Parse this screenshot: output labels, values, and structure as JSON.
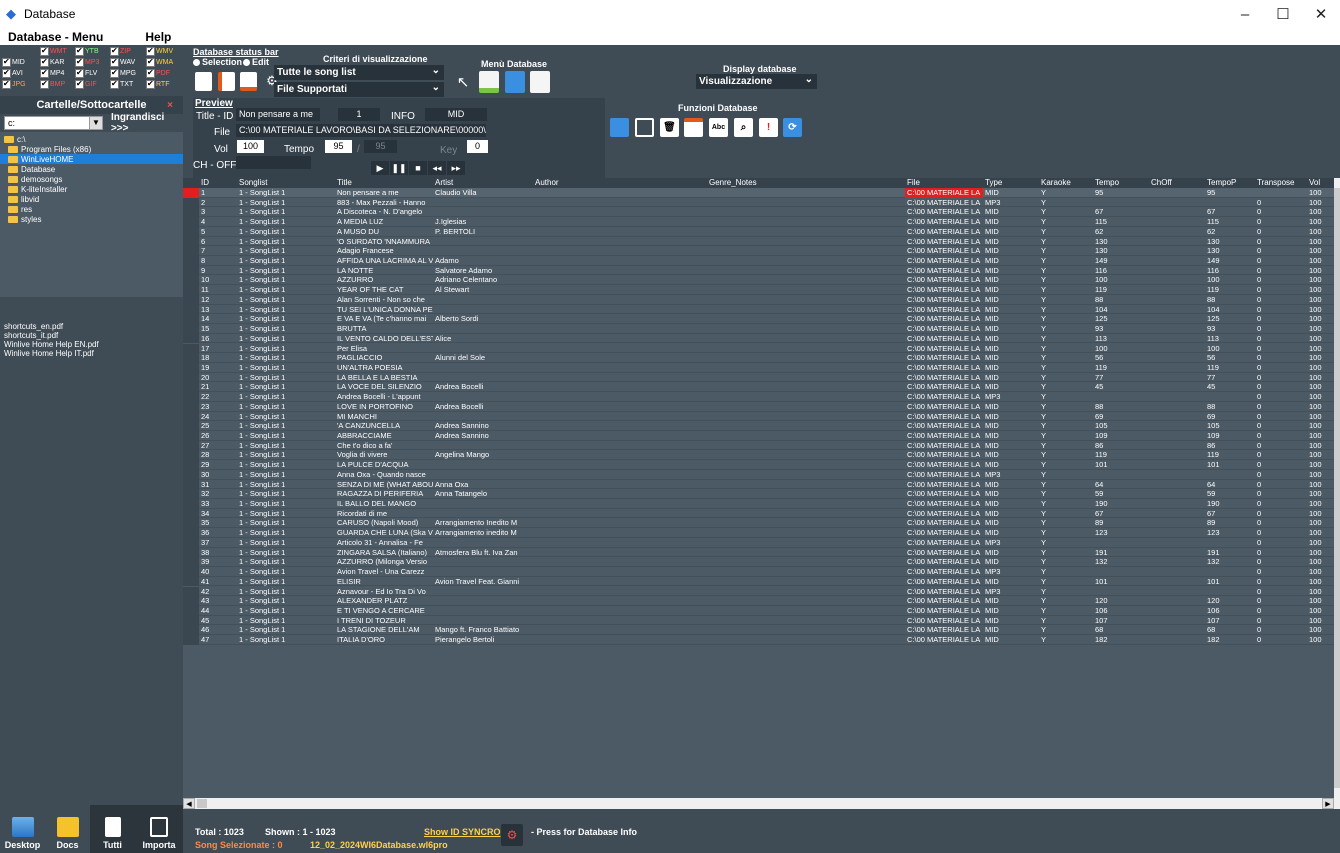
{
  "window": {
    "title": "Database",
    "minimize": "–",
    "maximize": "☐",
    "close": "✕"
  },
  "menu": {
    "items": [
      "Database - Menu",
      "Help"
    ]
  },
  "filetypes": [
    {
      "label": "WMT",
      "color": "red"
    },
    {
      "label": "YTB",
      "color": "grn"
    },
    {
      "label": "ZIP",
      "color": "red"
    },
    {
      "label": "WMV",
      "color": "yel"
    },
    {
      "label": "MID",
      "color": "lbl"
    },
    {
      "label": "KAR",
      "color": "lbl"
    },
    {
      "label": "MP3",
      "color": "red"
    },
    {
      "label": "WAV",
      "color": "lbl"
    },
    {
      "label": "WMA",
      "color": "yel"
    },
    {
      "label": "AVI",
      "color": "lbl"
    },
    {
      "label": "MP4",
      "color": "lbl"
    },
    {
      "label": "FLV",
      "color": "lbl"
    },
    {
      "label": "MPG",
      "color": "lbl"
    },
    {
      "label": "PDF",
      "color": "red"
    },
    {
      "label": "JPG",
      "color": "org"
    },
    {
      "label": "BMP",
      "color": "red"
    },
    {
      "label": "GIF",
      "color": "red"
    },
    {
      "label": "TXT",
      "color": "lbl"
    },
    {
      "label": "RTF",
      "color": "yel"
    }
  ],
  "folders": {
    "header": "Cartelle/Sottocartelle",
    "close": "×",
    "drive": "c:",
    "enlarge": "Ingrandisci >>>",
    "tree": [
      "c:\\",
      "Program Files (x86)",
      "WinLiveHOME",
      "Database",
      "demosongs",
      "K-liteInstaller",
      "libvid",
      "res",
      "styles"
    ],
    "selected_index": 2
  },
  "files": [
    "shortcuts_en.pdf",
    "shortcuts_it.pdf",
    "Winlive Home Help EN.pdf",
    "Winlive Home Help IT.pdf"
  ],
  "bottom_buttons": [
    "Desktop",
    "Docs",
    "Tutti",
    "Importa"
  ],
  "statusbar": {
    "label": "Database status bar",
    "selection": "Selection",
    "edit": "Edit"
  },
  "criteri": {
    "label": "Criteri di visualizzazione",
    "view": "Tutte le song list",
    "files": "File Supportati"
  },
  "menu_database": {
    "label": "Menù Database"
  },
  "display_database": {
    "label": "Display database",
    "value": "Visualizzazione"
  },
  "funzioni_database": {
    "label": "Funzioni Database"
  },
  "preview": {
    "label": "Preview",
    "title_id_label": "Title - ID",
    "title": "Non pensare a me",
    "id": "1",
    "info_label": "INFO",
    "type": "MID",
    "file_label": "File",
    "file": "C:\\00 MATERIALE LAVORO\\BASI DA SELEZIONARE\\00000\\Gui",
    "vol_label": "Vol",
    "vol": "100",
    "tempo_label": "Tempo",
    "tempo": "95",
    "slash": "/",
    "tempo_orig": "95",
    "key_label": "Key",
    "key": "0",
    "choff_label": "CH - OFF",
    "controls": [
      "▶",
      "❚❚",
      "■",
      "◂◂",
      "▸▸"
    ]
  },
  "grid": {
    "columns": [
      "ID",
      "Songlist",
      "Title",
      "Artist",
      "Author",
      "Genre_Notes",
      "File",
      "Type",
      "Karaoke",
      "Tempo",
      "ChOff",
      "TempoP",
      "Transpose",
      "Vol"
    ],
    "rows": [
      [
        "1",
        "1 - SongList 1",
        "Non pensare a me",
        "Claudio Villa",
        "",
        "",
        "C:\\00 MATERIALE LA",
        "MID",
        "Y",
        "95",
        "",
        "95",
        "",
        "100"
      ],
      [
        "2",
        "1 - SongList 1",
        "883 - Max Pezzali - Hanno",
        "",
        "",
        "",
        "C:\\00 MATERIALE LA",
        "MP3",
        "Y",
        "",
        "",
        "",
        "0",
        "100"
      ],
      [
        "3",
        "1 - SongList 1",
        "A Discoteca - N. D'angelo",
        "",
        "",
        "",
        "C:\\00 MATERIALE LA",
        "MID",
        "Y",
        "67",
        "",
        "67",
        "0",
        "100"
      ],
      [
        "4",
        "1 - SongList 1",
        "A MEDIA LUZ",
        "J.Iglesias",
        "",
        "",
        "C:\\00 MATERIALE LA",
        "MID",
        "Y",
        "115",
        "",
        "115",
        "0",
        "100"
      ],
      [
        "5",
        "1 - SongList 1",
        "A MUSO DU",
        "P. BERTOLI",
        "",
        "",
        "C:\\00 MATERIALE LA",
        "MID",
        "Y",
        "62",
        "",
        "62",
        "0",
        "100"
      ],
      [
        "6",
        "1 - SongList 1",
        "'O SURDATO 'NNAMMURA",
        "",
        "",
        "",
        "C:\\00 MATERIALE LA",
        "MID",
        "Y",
        "130",
        "",
        "130",
        "0",
        "100"
      ],
      [
        "7",
        "1 - SongList 1",
        "Adagio Francese",
        "",
        "",
        "",
        "C:\\00 MATERIALE LA",
        "MID",
        "Y",
        "130",
        "",
        "130",
        "0",
        "100"
      ],
      [
        "8",
        "1 - SongList 1",
        "AFFIDA UNA LACRIMA AL VE",
        "Adamo",
        "",
        "",
        "C:\\00 MATERIALE LA",
        "MID",
        "Y",
        "149",
        "",
        "149",
        "0",
        "100"
      ],
      [
        "9",
        "1 - SongList 1",
        "LA NOTTE",
        "Salvatore Adamo",
        "",
        "",
        "C:\\00 MATERIALE LA",
        "MID",
        "Y",
        "116",
        "",
        "116",
        "0",
        "100"
      ],
      [
        "10",
        "1 - SongList 1",
        "AZZURRO",
        "Adriano Celentano",
        "",
        "",
        "C:\\00 MATERIALE LA",
        "MID",
        "Y",
        "100",
        "",
        "100",
        "0",
        "100"
      ],
      [
        "11",
        "1 - SongList 1",
        "YEAR OF THE CAT",
        "Al Stewart",
        "",
        "",
        "C:\\00 MATERIALE LA",
        "MID",
        "Y",
        "119",
        "",
        "119",
        "0",
        "100"
      ],
      [
        "12",
        "1 - SongList 1",
        "Alan Sorrenti - Non so che",
        "",
        "",
        "",
        "C:\\00 MATERIALE LA",
        "MID",
        "Y",
        "88",
        "",
        "88",
        "0",
        "100"
      ],
      [
        "13",
        "1 - SongList 1",
        "TU SEI L'UNICA DONNA PER",
        "",
        "",
        "",
        "C:\\00 MATERIALE LA",
        "MID",
        "Y",
        "104",
        "",
        "104",
        "0",
        "100"
      ],
      [
        "14",
        "1 - SongList 1",
        "E VA E VA (Te c'hanno mai",
        "Alberto Sordi",
        "",
        "",
        "C:\\00 MATERIALE LA",
        "MID",
        "Y",
        "125",
        "",
        "125",
        "0",
        "100"
      ],
      [
        "15",
        "1 - SongList 1",
        "BRUTTA",
        "",
        "",
        "",
        "C:\\00 MATERIALE LA",
        "MID",
        "Y",
        "93",
        "",
        "93",
        "0",
        "100"
      ],
      [
        "16",
        "1 - SongList 1",
        "IL VENTO CALDO DELL'EST",
        "Alice",
        "",
        "",
        "C:\\00 MATERIALE LA",
        "MID",
        "Y",
        "113",
        "",
        "113",
        "0",
        "100"
      ],
      [
        "17",
        "1 - SongList 1",
        "Per Elisa",
        "",
        "",
        "",
        "C:\\00 MATERIALE LA",
        "MID",
        "Y",
        "100",
        "",
        "100",
        "0",
        "100"
      ],
      [
        "18",
        "1 - SongList 1",
        "PAGLIACCIO",
        "Alunni del Sole",
        "",
        "",
        "C:\\00 MATERIALE LA",
        "MID",
        "Y",
        "56",
        "",
        "56",
        "0",
        "100"
      ],
      [
        "19",
        "1 - SongList 1",
        "UN'ALTRA POESIA",
        "",
        "",
        "",
        "C:\\00 MATERIALE LA",
        "MID",
        "Y",
        "119",
        "",
        "119",
        "0",
        "100"
      ],
      [
        "20",
        "1 - SongList 1",
        "LA BELLA E LA BESTIA",
        "",
        "",
        "",
        "C:\\00 MATERIALE LA",
        "MID",
        "Y",
        "77",
        "",
        "77",
        "0",
        "100"
      ],
      [
        "21",
        "1 - SongList 1",
        "LA VOCE DEL SILENZIO",
        "Andrea Bocelli",
        "",
        "",
        "C:\\00 MATERIALE LA",
        "MID",
        "Y",
        "45",
        "",
        "45",
        "0",
        "100"
      ],
      [
        "22",
        "1 - SongList 1",
        "Andrea Bocelli - L'appunt",
        "",
        "",
        "",
        "C:\\00 MATERIALE LA",
        "MP3",
        "Y",
        "",
        "",
        "",
        "0",
        "100"
      ],
      [
        "23",
        "1 - SongList 1",
        "LOVE IN PORTOFINO",
        "Andrea Bocelli",
        "",
        "",
        "C:\\00 MATERIALE LA",
        "MID",
        "Y",
        "88",
        "",
        "88",
        "0",
        "100"
      ],
      [
        "24",
        "1 - SongList 1",
        "MI MANCHI",
        "",
        "",
        "",
        "C:\\00 MATERIALE LA",
        "MID",
        "Y",
        "69",
        "",
        "69",
        "0",
        "100"
      ],
      [
        "25",
        "1 - SongList 1",
        "'A CANZUNCELLA",
        "Andrea Sannino",
        "",
        "",
        "C:\\00 MATERIALE LA",
        "MID",
        "Y",
        "105",
        "",
        "105",
        "0",
        "100"
      ],
      [
        "26",
        "1 - SongList 1",
        "ABBRACCIAME",
        "Andrea Sannino",
        "",
        "",
        "C:\\00 MATERIALE LA",
        "MID",
        "Y",
        "109",
        "",
        "109",
        "0",
        "100"
      ],
      [
        "27",
        "1 - SongList 1",
        "Che t'o dico a fa'",
        "",
        "",
        "",
        "C:\\00 MATERIALE LA",
        "MID",
        "Y",
        "86",
        "",
        "86",
        "0",
        "100"
      ],
      [
        "28",
        "1 - SongList 1",
        "Voglia di vivere",
        "Angelina Mango",
        "",
        "",
        "C:\\00 MATERIALE LA",
        "MID",
        "Y",
        "119",
        "",
        "119",
        "0",
        "100"
      ],
      [
        "29",
        "1 - SongList 1",
        "LA PULCE D'ACQUA",
        "",
        "",
        "",
        "C:\\00 MATERIALE LA",
        "MID",
        "Y",
        "101",
        "",
        "101",
        "0",
        "100"
      ],
      [
        "30",
        "1 - SongList 1",
        "Anna Oxa - Quando nasce",
        "",
        "",
        "",
        "C:\\00 MATERIALE LA",
        "MP3",
        "Y",
        "",
        "",
        "",
        "0",
        "100"
      ],
      [
        "31",
        "1 - SongList 1",
        "SENZA DI ME (WHAT ABOU",
        "Anna Oxa",
        "",
        "",
        "C:\\00 MATERIALE LA",
        "MID",
        "Y",
        "64",
        "",
        "64",
        "0",
        "100"
      ],
      [
        "32",
        "1 - SongList 1",
        "RAGAZZA DI PERIFERIA",
        "Anna Tatangelo",
        "",
        "",
        "C:\\00 MATERIALE LA",
        "MID",
        "Y",
        "59",
        "",
        "59",
        "0",
        "100"
      ],
      [
        "33",
        "1 - SongList 1",
        "IL BALLO DEL MANGO",
        "",
        "",
        "",
        "C:\\00 MATERIALE LA",
        "MID",
        "Y",
        "190",
        "",
        "190",
        "0",
        "100"
      ],
      [
        "34",
        "1 - SongList 1",
        "Ricordati di me",
        "",
        "",
        "",
        "C:\\00 MATERIALE LA",
        "MID",
        "Y",
        "67",
        "",
        "67",
        "0",
        "100"
      ],
      [
        "35",
        "1 - SongList 1",
        "CARUSO (Napoli Mood)",
        "Arrangiamento Inedito M",
        "",
        "",
        "C:\\00 MATERIALE LA",
        "MID",
        "Y",
        "89",
        "",
        "89",
        "0",
        "100"
      ],
      [
        "36",
        "1 - SongList 1",
        "GUARDA CHE LUNA (Ska V",
        "Arrangiamento inedito M",
        "",
        "",
        "C:\\00 MATERIALE LA",
        "MID",
        "Y",
        "123",
        "",
        "123",
        "0",
        "100"
      ],
      [
        "37",
        "1 - SongList 1",
        "Articolo 31 - Annalisa - Fe",
        "",
        "",
        "",
        "C:\\00 MATERIALE LA",
        "MP3",
        "Y",
        "",
        "",
        "",
        "0",
        "100"
      ],
      [
        "38",
        "1 - SongList 1",
        "ZINGARA SALSA (Italiano)",
        "Atmosfera Blu ft. Iva Zan",
        "",
        "",
        "C:\\00 MATERIALE LA",
        "MID",
        "Y",
        "191",
        "",
        "191",
        "0",
        "100"
      ],
      [
        "39",
        "1 - SongList 1",
        "AZZURRO (Milonga Versio",
        "",
        "",
        "",
        "C:\\00 MATERIALE LA",
        "MID",
        "Y",
        "132",
        "",
        "132",
        "0",
        "100"
      ],
      [
        "40",
        "1 - SongList 1",
        "Avion Travel - Una Carezz",
        "",
        "",
        "",
        "C:\\00 MATERIALE LA",
        "MP3",
        "Y",
        "",
        "",
        "",
        "0",
        "100"
      ],
      [
        "41",
        "1 - SongList 1",
        "ELISIR",
        "Avion Travel Feat. Gianni",
        "",
        "",
        "C:\\00 MATERIALE LA",
        "MID",
        "Y",
        "101",
        "",
        "101",
        "0",
        "100"
      ],
      [
        "42",
        "1 - SongList 1",
        "Aznavour - Ed Io Tra Di Vo",
        "",
        "",
        "",
        "C:\\00 MATERIALE LA",
        "MP3",
        "Y",
        "",
        "",
        "",
        "0",
        "100"
      ],
      [
        "43",
        "1 - SongList 1",
        "ALEXANDER PLATZ",
        "",
        "",
        "",
        "C:\\00 MATERIALE LA",
        "MID",
        "Y",
        "120",
        "",
        "120",
        "0",
        "100"
      ],
      [
        "44",
        "1 - SongList 1",
        "E TI VENGO A CERCARE",
        "",
        "",
        "",
        "C:\\00 MATERIALE LA",
        "MID",
        "Y",
        "106",
        "",
        "106",
        "0",
        "100"
      ],
      [
        "45",
        "1 - SongList 1",
        "I TRENI DI TOZEUR",
        "",
        "",
        "",
        "C:\\00 MATERIALE LA",
        "MID",
        "Y",
        "107",
        "",
        "107",
        "0",
        "100"
      ],
      [
        "46",
        "1 - SongList 1",
        "LA STAGIONE DELL'AM",
        "Mango ft. Franco Battiato",
        "",
        "",
        "C:\\00 MATERIALE LA",
        "MID",
        "Y",
        "68",
        "",
        "68",
        "0",
        "100"
      ],
      [
        "47",
        "1 - SongList 1",
        "ITALIA D'ORO",
        "Pierangelo Bertoli",
        "",
        "",
        "C:\\00 MATERIALE LA",
        "MID",
        "Y",
        "182",
        "",
        "182",
        "0",
        "100"
      ]
    ]
  },
  "footer": {
    "total": "Total : 1023",
    "shown": "Shown : 1 - 1023",
    "selected": "Song Selezionate : 0",
    "dbfile": "12_02_2024WI6Database.wl6pro",
    "sync": "Show ID SYNCRO",
    "info": "- Press for Database Info"
  }
}
